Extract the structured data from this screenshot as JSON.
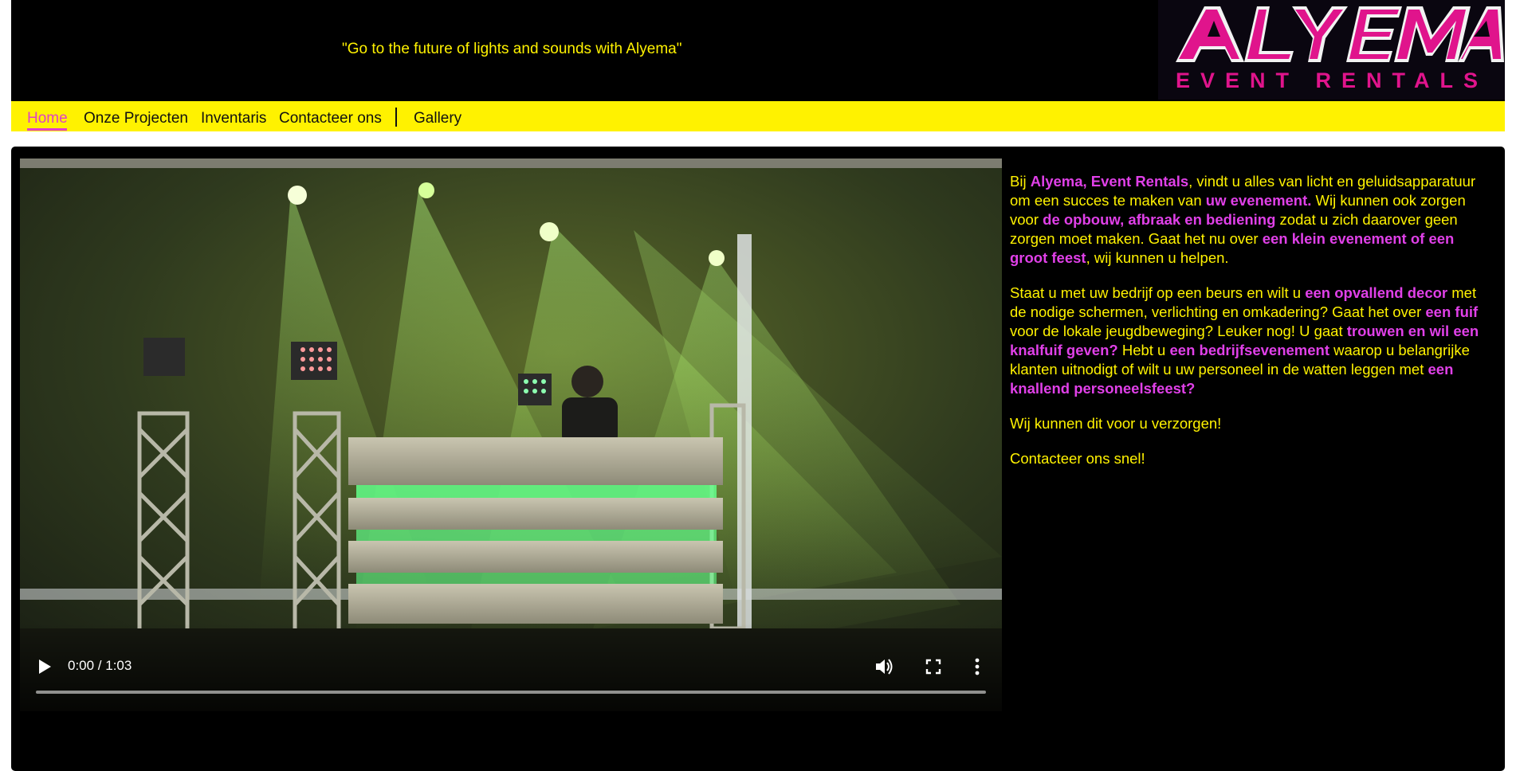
{
  "header": {
    "tagline": "\"Go to the future of lights and sounds with Alyema\"",
    "logo": {
      "name": "ALYEMA",
      "sub": "EVENT RENTALS",
      "brand_color": "#e0148c"
    }
  },
  "nav": {
    "items": [
      {
        "label": "Home",
        "active": true
      },
      {
        "label": "Onze Projecten"
      },
      {
        "label": "Inventaris"
      },
      {
        "label": "Contacteer ons"
      },
      {
        "label": "Gallery"
      }
    ]
  },
  "video": {
    "time": "0:00 / 1:03",
    "progress": 0,
    "icons": [
      "play-icon",
      "volume-icon",
      "fullscreen-icon",
      "more-options-icon"
    ]
  },
  "content": {
    "p1": [
      {
        "t": "Bij "
      },
      {
        "t": "Alyema, Event Rentals",
        "h": true
      },
      {
        "t": ", vindt u alles van licht en geluidsapparatuur om een succes te maken van "
      },
      {
        "t": "uw evenement.",
        "h": true
      },
      {
        "t": " Wij kunnen ook zorgen voor "
      },
      {
        "t": "de opbouw, afbraak en bediening",
        "h": true
      },
      {
        "t": " zodat u zich daarover geen zorgen moet maken. Gaat het nu over "
      },
      {
        "t": "een klein evenement of een groot feest",
        "h": true
      },
      {
        "t": ", wij kunnen u helpen."
      }
    ],
    "p2": [
      {
        "t": "Staat u met uw bedrijf op een beurs en wilt u "
      },
      {
        "t": "een opvallend decor",
        "h": true
      },
      {
        "t": " met de nodige schermen, verlichting en omkadering? Gaat het over "
      },
      {
        "t": "een fuif",
        "h": true
      },
      {
        "t": " voor de lokale jeugdbeweging? Leuker nog! U gaat "
      },
      {
        "t": "trouwen en wil een knalfuif geven?",
        "h": true
      },
      {
        "t": " Hebt u "
      },
      {
        "t": "een bedrijfsevenement",
        "h": true
      },
      {
        "t": " waarop u belangrijke klanten uitnodigt of wilt u uw personeel in de watten leggen met "
      },
      {
        "t": "een knallend personeelsfeest?",
        "h": true
      }
    ],
    "p3": "Wij kunnen dit voor u verzorgen!",
    "p4": "Contacteer ons snel!"
  },
  "colors": {
    "accent_yellow": "#fff200",
    "highlight_magenta": "#e040e8",
    "background": "#000000"
  }
}
